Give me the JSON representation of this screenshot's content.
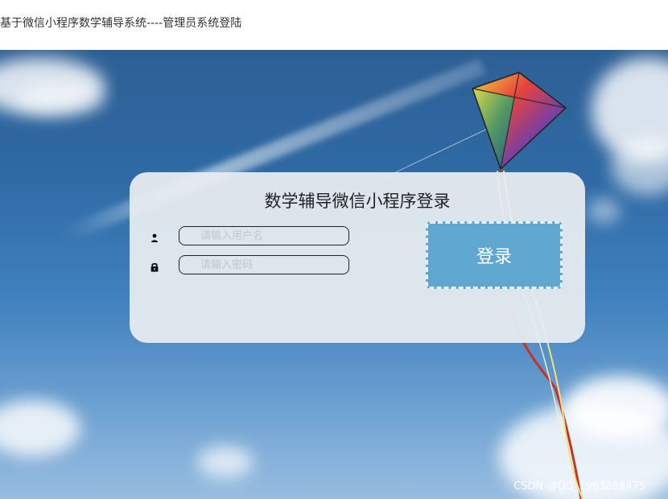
{
  "page": {
    "header_title": "基于微信小程序数学辅导系统----管理员系统登陆"
  },
  "login": {
    "title": "数学辅导微信小程序登录",
    "username_placeholder": "请输入用户名",
    "password_placeholder": "请输入密码",
    "login_button": "登录",
    "username_icon": "user-icon",
    "password_icon": "lock-icon"
  },
  "watermark": {
    "text": "CSDN @QQ_1963288475"
  },
  "colors": {
    "button": "#5fa7cf",
    "card": "#e8ecf0",
    "sky": "#2f6aa4"
  }
}
